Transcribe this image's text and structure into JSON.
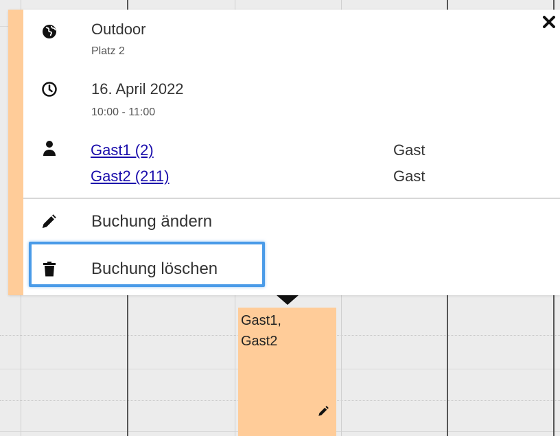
{
  "popup": {
    "location": {
      "title": "Outdoor",
      "subtitle": "Platz 2",
      "icon": "globe-icon"
    },
    "time": {
      "date": "16. April 2022",
      "range": "10:00 - 11:00",
      "icon": "clock-icon"
    },
    "participants": {
      "icon": "person-icon",
      "items": [
        {
          "name": "Gast1 (2)",
          "role": "Gast"
        },
        {
          "name": "Gast2 (211)",
          "role": "Gast"
        }
      ]
    },
    "actions": {
      "edit_label": "Buchung ändern",
      "delete_label": "Buchung löschen"
    },
    "close_icon": "close-icon"
  },
  "event": {
    "text": "Gast1,\nGast2",
    "color": "#ffcc99"
  },
  "colors": {
    "accent": "#ffcc99",
    "highlight": "#4a9be8",
    "link": "#1a0dab"
  }
}
